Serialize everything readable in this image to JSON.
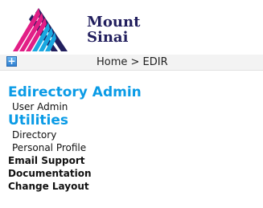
{
  "logo": {
    "line1": "Mount",
    "line2": "Sinai",
    "colors": [
      "#221f5e",
      "#e21e86",
      "#19a7e0"
    ]
  },
  "header": {
    "expand_icon": "plus-icon",
    "breadcrumb": "Home > EDIR"
  },
  "nav": {
    "edirectory_title": "Edirectory Admin",
    "user_admin": "User Admin",
    "utilities_title": "Utilities",
    "directory": "Directory",
    "personal_profile": "Personal Profile",
    "email_support": "Email Support",
    "documentation": "Documentation",
    "change_layout": "Change Layout"
  }
}
